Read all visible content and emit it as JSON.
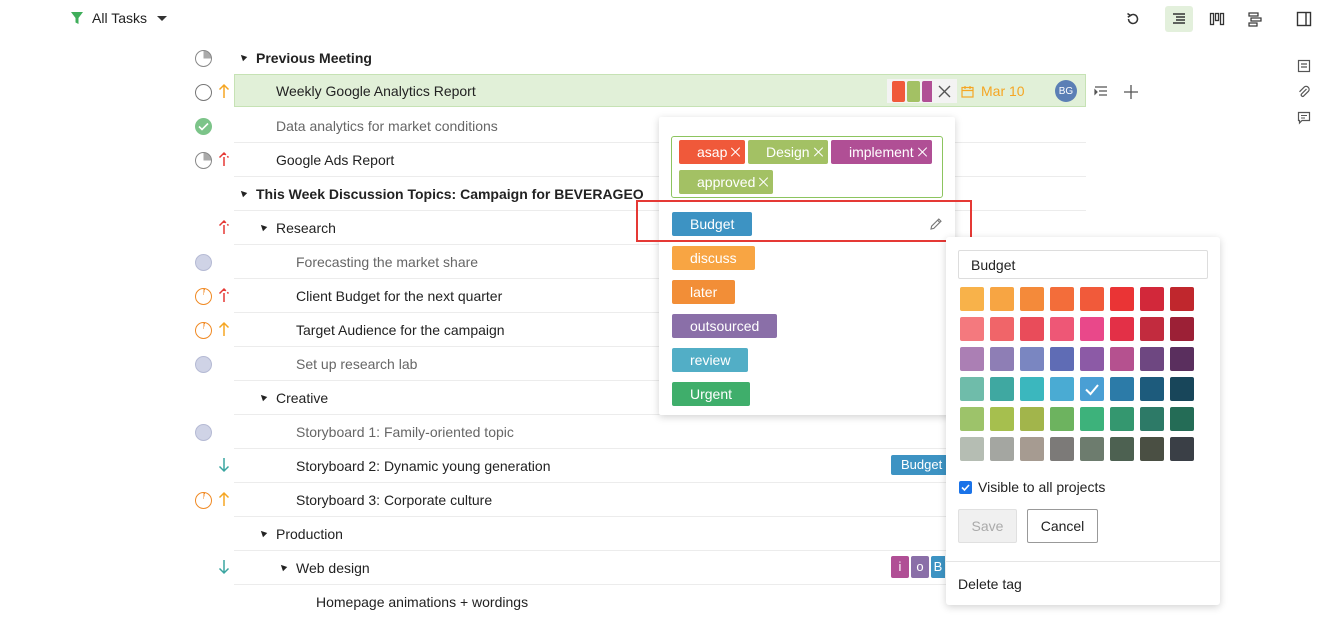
{
  "toolbar": {
    "filter_label": "All Tasks"
  },
  "sections": {
    "previous": "Previous Meeting",
    "this_week": "This Week Discussion Topics: Campaign for BEVERAGEO",
    "research": "Research",
    "creative": "Creative",
    "production": "Production",
    "web_design": "Web design"
  },
  "tasks": {
    "weekly": "Weekly Google Analytics Report",
    "data_analytics": "Data analytics for market conditions",
    "google_ads": "Google Ads Report",
    "forecasting": "Forecasting the market share",
    "client_budget": "Client Budget for the next quarter",
    "target_audience": "Target Audience for the campaign",
    "research_lab": "Set up research lab",
    "storyboard1": "Storyboard 1: Family-oriented topic",
    "storyboard2": "Storyboard 2: Dynamic young generation",
    "storyboard3": "Storyboard 3: Corporate culture",
    "homepage": "Homepage animations + wordings"
  },
  "selected_row": {
    "due_date": "Mar 10",
    "assignee": "BG"
  },
  "row_tags": {
    "storyboard2": "Budget",
    "web_i": "i",
    "web_o": "o",
    "web_b": "B"
  },
  "tag_dropdown": {
    "applied": [
      {
        "label": "asap",
        "color": "#f0593a"
      },
      {
        "label": "Design",
        "color": "#a3c164"
      },
      {
        "label": "implement",
        "color": "#b04f95"
      },
      {
        "label": "approved",
        "color": "#a3c164"
      }
    ],
    "list": [
      {
        "label": "Budget",
        "color": "#3d93c3"
      },
      {
        "label": "discuss",
        "color": "#f8a543"
      },
      {
        "label": "later",
        "color": "#f28e37"
      },
      {
        "label": "outsourced",
        "color": "#8a6fa8"
      },
      {
        "label": "review",
        "color": "#52aec6"
      },
      {
        "label": "Urgent",
        "color": "#3fae6b"
      }
    ]
  },
  "tag_editor": {
    "name_value": "Budget",
    "visible_label": "Visible to all projects",
    "save_label": "Save",
    "cancel_label": "Cancel",
    "delete_label": "Delete tag",
    "selected_color": "#4a9fd4",
    "palette": [
      [
        "#f8b24a",
        "#f7a543",
        "#f48a3a",
        "#f36d3a",
        "#f15a3a",
        "#ea3435",
        "#d2283a",
        "#c0272d"
      ],
      [
        "#f4797e",
        "#f06569",
        "#e94c5a",
        "#ee5776",
        "#e9488a",
        "#e33047",
        "#c22b3e",
        "#9c2036"
      ],
      [
        "#ab7fb4",
        "#8e7eb5",
        "#7a86c1",
        "#5f6cb5",
        "#8c5aa6",
        "#b5518f",
        "#6e4781",
        "#5a2f5e"
      ],
      [
        "#6fbcaa",
        "#3fa8a1",
        "#3bb7be",
        "#4aabd3",
        "#4a9fd4",
        "#2c7ba8",
        "#1d5b7c",
        "#18465a"
      ],
      [
        "#9dc36a",
        "#a6bf4e",
        "#a2b54b",
        "#6db35f",
        "#3db27b",
        "#34976f",
        "#2d7a67",
        "#246c56"
      ],
      [
        "#b5bdb3",
        "#a4a6a1",
        "#a69b91",
        "#7c7a78",
        "#6d7c6e",
        "#4d6151",
        "#4a4f43",
        "#3a3f46"
      ]
    ]
  }
}
